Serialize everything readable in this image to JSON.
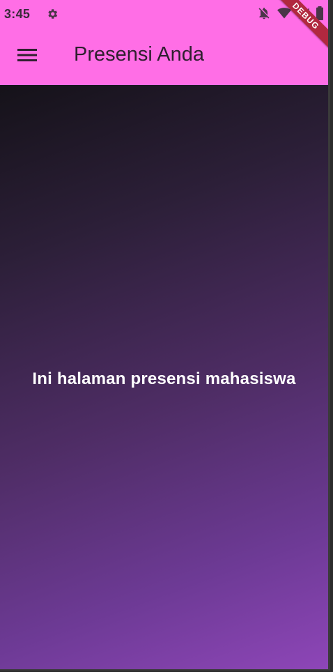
{
  "status_bar": {
    "time": "3:45",
    "icons": [
      "settings-icon",
      "notifications-off-icon",
      "wifi-icon",
      "signal-icon",
      "battery-icon"
    ]
  },
  "app_bar": {
    "menu_icon": "menu-icon",
    "title": "Presensi Anda",
    "background_color": "#ff6ee6"
  },
  "body": {
    "message": "Ini halaman presensi mahasiswa",
    "gradient_colors": [
      "#151219",
      "#8e46b8"
    ]
  },
  "debug_banner": {
    "label": "DEBUG"
  }
}
